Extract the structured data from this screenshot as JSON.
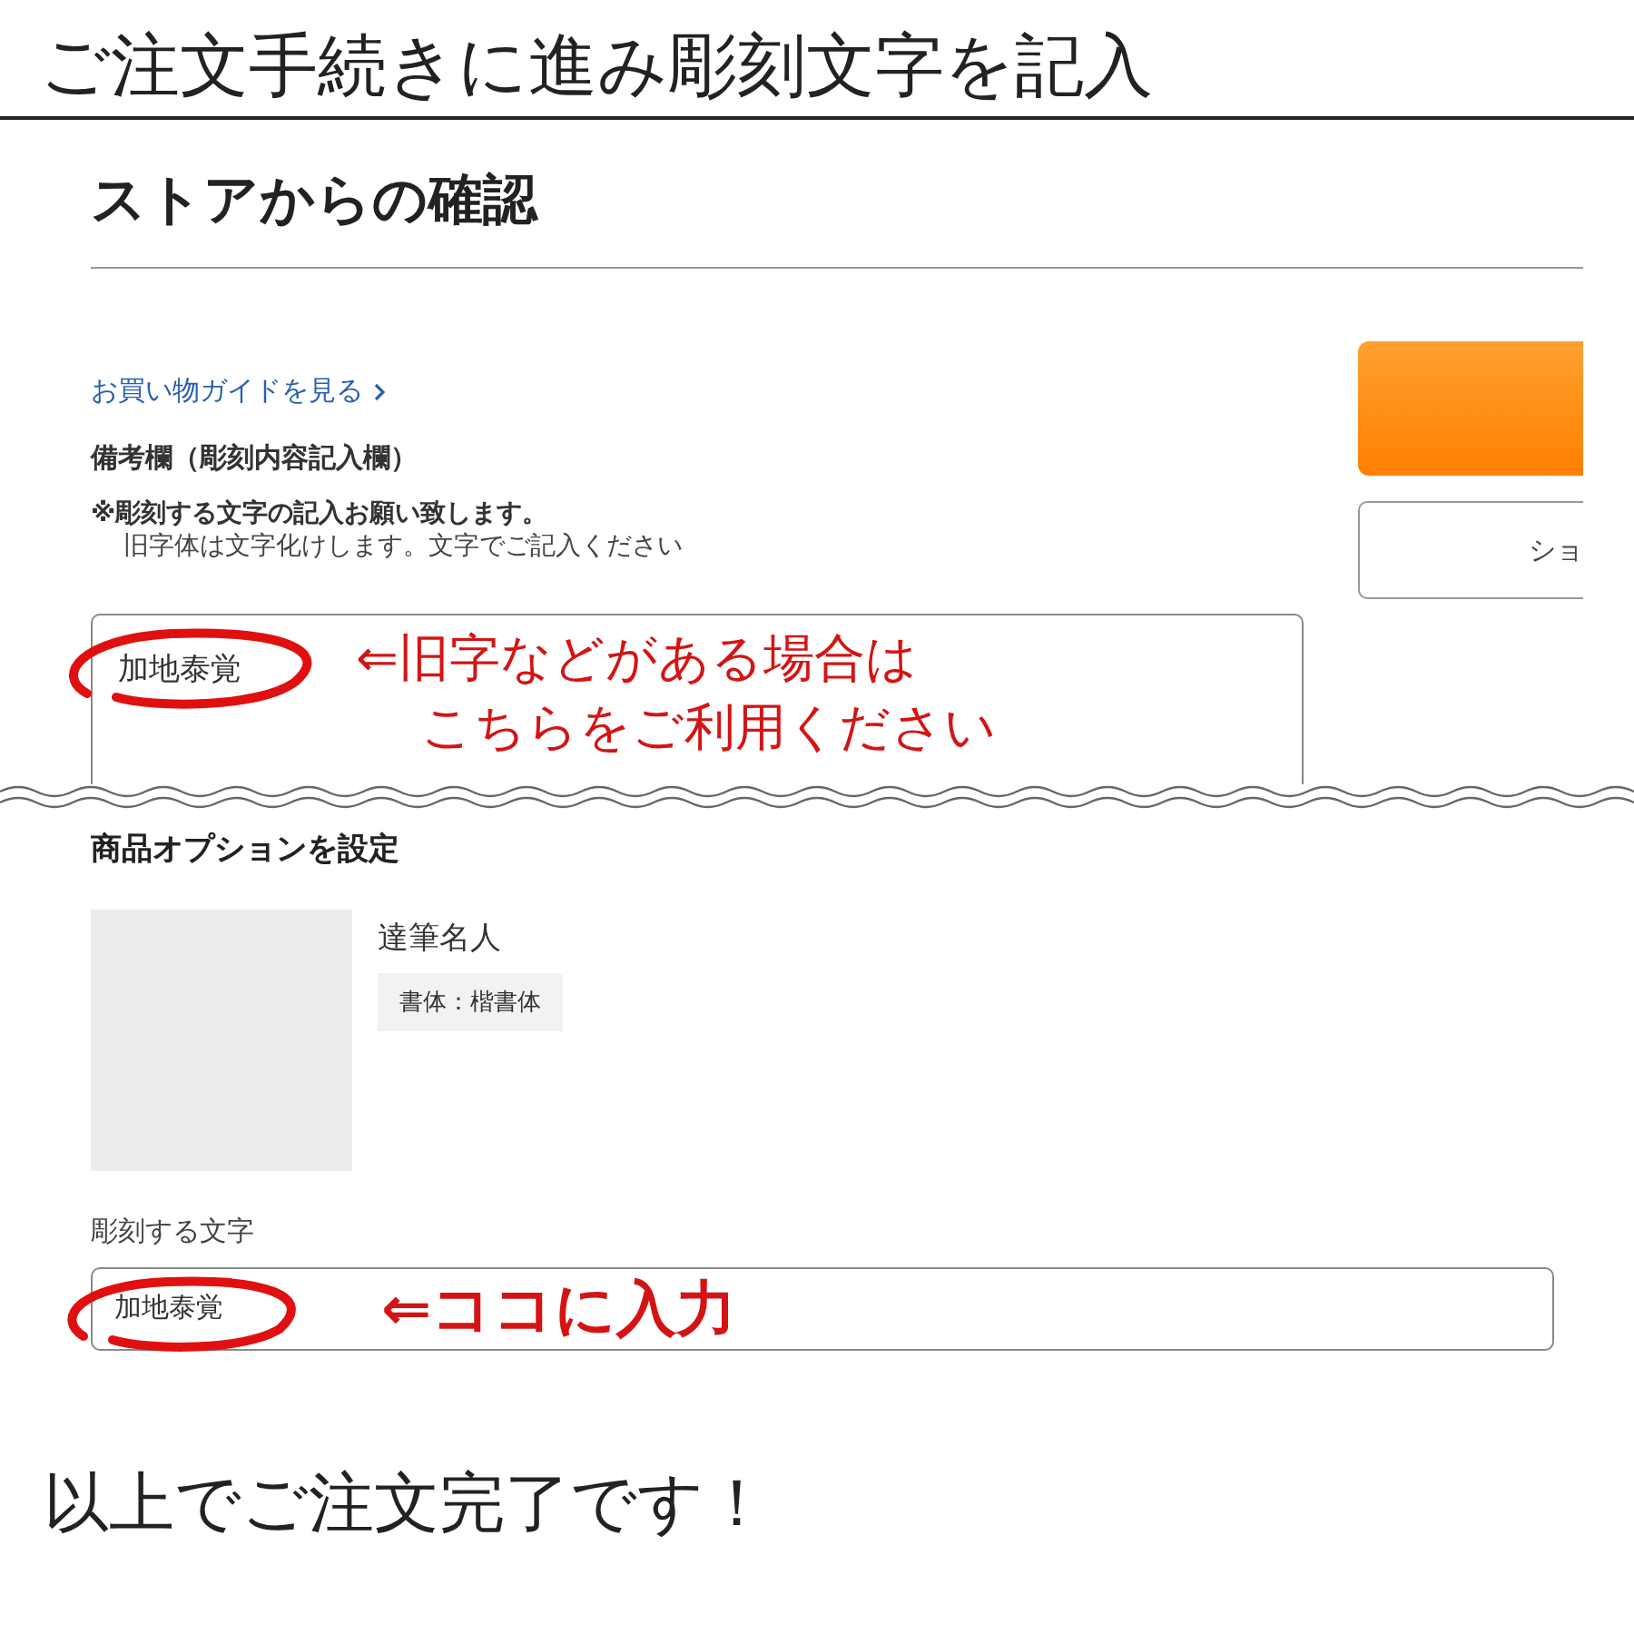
{
  "header": {
    "title": "ご注文手続きに進み彫刻文字を記入"
  },
  "confirm": {
    "title": "ストアからの確認",
    "guide_link": "お買い物ガイドを見る",
    "remarks_label": "備考欄（彫刻内容記入欄）",
    "note_bold": "※彫刻する文字の記入お願い致します。",
    "note": "旧字体は文字化けします。文字でご記入ください",
    "remarks_value": "加地泰覚",
    "annotation_lines": [
      "⇐旧字などがある場合は",
      "こちらをご利用ください"
    ],
    "secondary_button": "ショ"
  },
  "options": {
    "title": "商品オプションを設定",
    "product_name": "達筆名人",
    "option_tag": "書体：楷書体",
    "engraving_label": "彫刻する文字",
    "engraving_value": "加地泰覚",
    "annotation": "⇐ココに入力"
  },
  "footer": {
    "text": "以上でご注文完了です！"
  }
}
